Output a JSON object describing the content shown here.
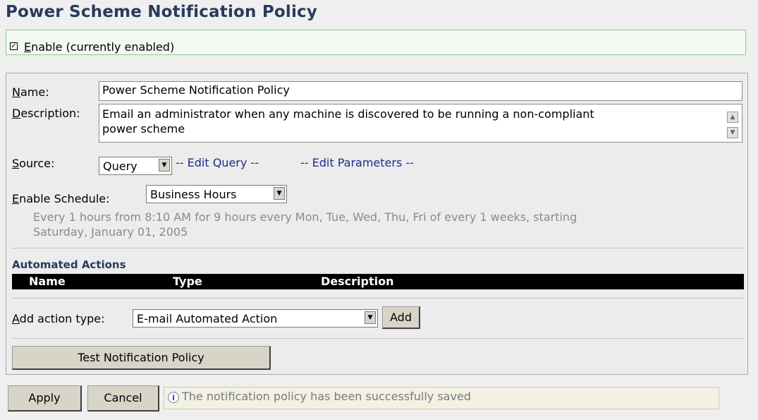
{
  "page": {
    "title": "Power Scheme Notification Policy"
  },
  "enable": {
    "checked": true,
    "label_accel": "E",
    "label_rest": "nable (currently enabled)"
  },
  "form": {
    "name_label_accel": "N",
    "name_label_rest": "ame:",
    "name_value": "Power Scheme Notification Policy",
    "description_label_accel": "D",
    "description_label_rest": "escription:",
    "description_line1": "Email an administrator when any machine is discovered to be running a non-compliant",
    "description_line2": "power scheme",
    "source_label_accel": "S",
    "source_label_rest": "ource:",
    "source_value": "Query",
    "edit_query_link": "-- Edit Query --",
    "edit_parameters_link": "-- Edit Parameters --",
    "schedule_label_accel": "E",
    "schedule_label_rest": "nable Schedule:",
    "schedule_value": "Business Hours",
    "schedule_description_line1": "Every 1 hours from 8:10 AM for 9 hours every Mon, Tue, Wed, Thu, Fri of every 1 weeks, starting",
    "schedule_description_line2": "Saturday, January 01, 2005"
  },
  "actions": {
    "section_title": "Automated Actions",
    "columns": [
      "Name",
      "Type",
      "Description"
    ],
    "rows": [],
    "add_label_accel": "A",
    "add_label_rest": "dd action type:",
    "add_type_value": "E-mail Automated Action",
    "add_button": "Add"
  },
  "test_button": "Test Notification Policy",
  "footer": {
    "apply_button": "Apply",
    "cancel_button": "Cancel",
    "status_message": "The notification policy has been successfully saved"
  }
}
